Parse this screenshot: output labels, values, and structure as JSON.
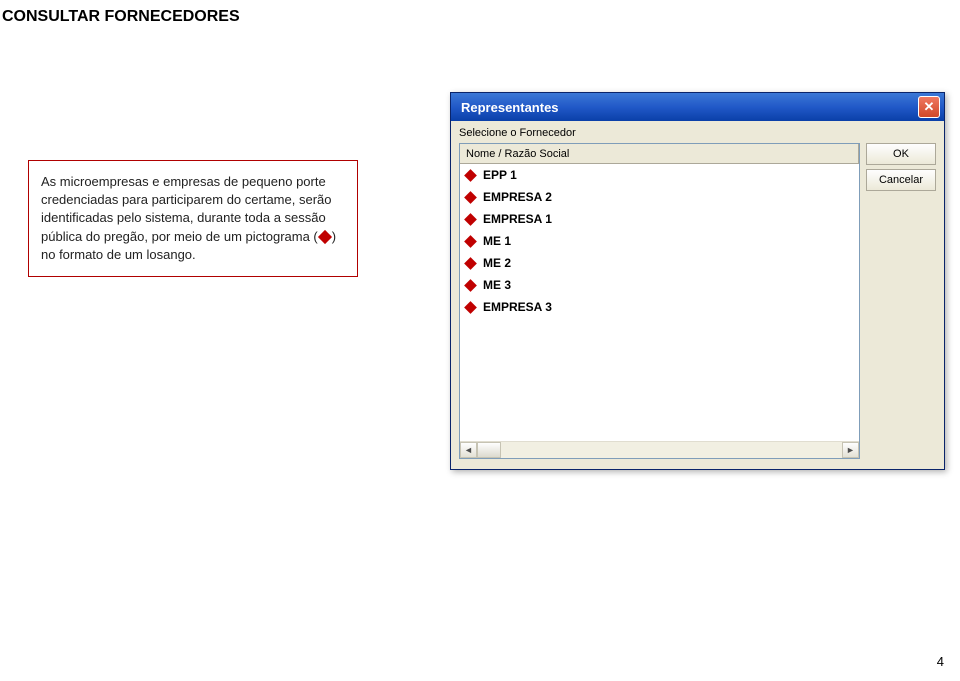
{
  "page": {
    "title": "CONSULTAR FORNECEDORES",
    "number": "4"
  },
  "info": {
    "text_before": "As microempresas e empresas de pequeno porte credenciadas para participarem do certame, serão identificadas pelo sistema, durante toda a sessão pública do pregão, por meio de um pictograma (",
    "text_after": ") no formato de um losango."
  },
  "dialog": {
    "title": "Representantes",
    "label": "Selecione o Fornecedor",
    "column_header": "Nome / Razão Social",
    "buttons": {
      "ok": "OK",
      "cancel": "Cancelar"
    },
    "rows": [
      {
        "label": "EPP 1"
      },
      {
        "label": "EMPRESA 2"
      },
      {
        "label": "EMPRESA 1"
      },
      {
        "label": "ME 1"
      },
      {
        "label": "ME 2"
      },
      {
        "label": "ME 3"
      },
      {
        "label": "EMPRESA 3"
      }
    ]
  }
}
